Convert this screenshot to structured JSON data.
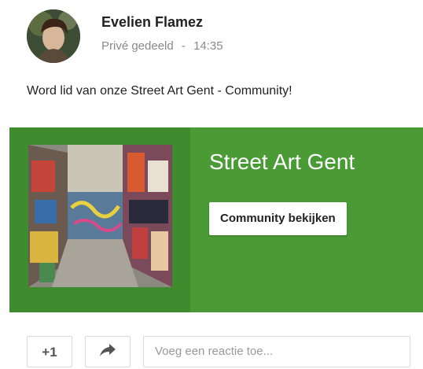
{
  "post": {
    "author_name": "Evelien Flamez",
    "visibility": "Privé gedeeld",
    "separator": "-",
    "time": "14:35",
    "text": "Word lid van onze Street Art Gent - Community!"
  },
  "community_card": {
    "title": "Street Art Gent",
    "view_button_label": "Community bekijken",
    "background_color": "#4a9a36"
  },
  "actions": {
    "plus_one_label": "+1",
    "share_icon": "share-icon",
    "comment_placeholder": "Voeg een reactie toe..."
  }
}
